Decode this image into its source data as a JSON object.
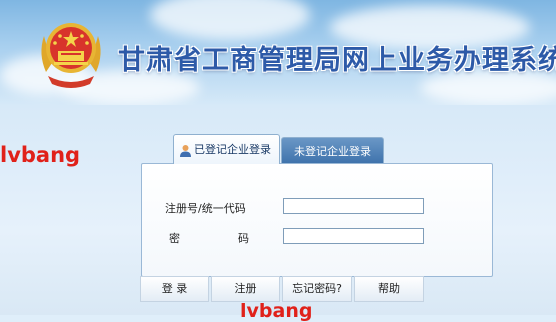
{
  "header": {
    "title": "甘肃省工商管理局网上业务办理系统",
    "emblem_icon": "national-emblem-icon"
  },
  "tabs": [
    {
      "label": "已登记企业登录",
      "active": true,
      "icon": "user-icon"
    },
    {
      "label": "未登记企业登录",
      "active": false
    }
  ],
  "form": {
    "reg_label": "注册号/统一代码",
    "pwd_label_1": "密",
    "pwd_label_2": "码",
    "reg_value": "",
    "pwd_value": ""
  },
  "buttons": {
    "login": "登 录",
    "register": "注册",
    "forgot": "忘记密码?",
    "help": "帮助"
  },
  "watermarks": [
    "lvbang",
    "lvbang"
  ],
  "colors": {
    "title": "#2d5aa8",
    "inactive_tab": "#3e72ab",
    "watermark": "#e0211a"
  }
}
